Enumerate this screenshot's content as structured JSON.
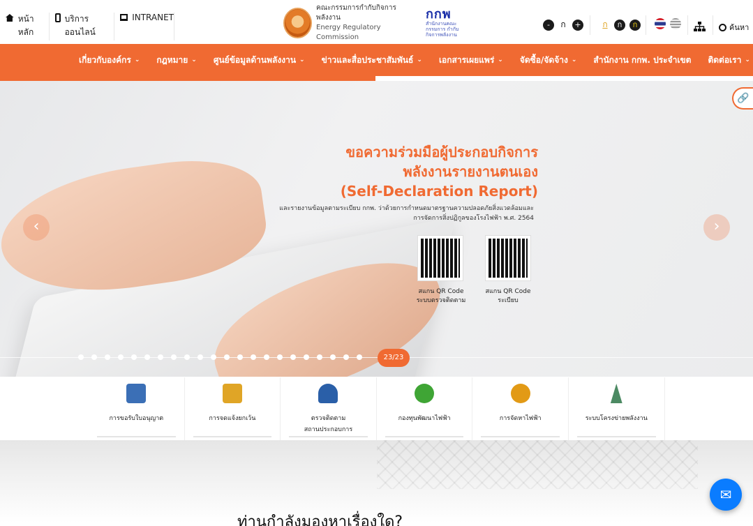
{
  "topbar": {
    "home": "หน้าหลัก",
    "online": "บริการออนไลน์",
    "intranet": "INTRANET",
    "font_minus": "-",
    "font_normal": "ก",
    "font_plus": "+",
    "contrast_normal": "ก",
    "contrast_dark": "ก",
    "contrast_yellow": "ก",
    "search": "ค้นหา"
  },
  "logo": {
    "org_th": "คณะกรรมการกำกับกิจการพลังงาน",
    "org_en": "Energy Regulatory Commission",
    "brand": "กกพ",
    "brand_sub": "สำนักงานคณะกรรมการ กำกับกิจการพลังงาน"
  },
  "nav": {
    "items": [
      "เกี่ยวกับองค์กร",
      "กฎหมาย",
      "ศูนย์ข้อมูลด้านพลังงาน",
      "ข่าวและสื่อประชาสัมพันธ์",
      "เอกสารเผยแพร่",
      "จัดซื้อ/จัดจ้าง",
      "สำนักงาน กกพ. ประจำเขต",
      "ติดต่อเรา"
    ]
  },
  "slide": {
    "title1": "ขอความร่วมมือผู้ประกอบกิจการ",
    "title2": "พลังงานรายงานตนเอง",
    "title3": "(Self-Declaration Report)",
    "sub1": "และรายงานข้อมูลตามระเบียบ กกพ. ว่าด้วยการกำหนดมาตรฐานความปลอดภัยสิ่งแวดล้อมและ",
    "sub2": "การจัดการสิ่งปฏิกูลของโรงไฟฟ้า พ.ศ. 2564",
    "qr1_line1": "สแกน QR Code",
    "qr1_line2": "ระบบตรวจติดตาม",
    "qr2_line1": "สแกน QR Code",
    "qr2_line2": "ระเบียบ",
    "counter": "23/23",
    "dot_count": 22
  },
  "services": [
    {
      "label": "การขอรับใบอนุญาต",
      "icon": "document-icon",
      "color": "#3b6fb6"
    },
    {
      "label": "การจดแจ้งยกเว้น",
      "icon": "clipboard-icon",
      "color": "#e0a526"
    },
    {
      "label": "ตรวจติดตาม สถานประกอบการ",
      "icon": "inspector-icon",
      "color": "#2a5fa8"
    },
    {
      "label": "กองทุนพัฒนาไฟฟ้า",
      "icon": "tree-icon",
      "color": "#3fa535"
    },
    {
      "label": "การจัดหาไฟฟ้า",
      "icon": "energy-hand-icon",
      "color": "#e29a16"
    },
    {
      "label": "ระบบโครงข่ายพลังงาน",
      "icon": "power-tower-icon",
      "color": "#4c8a63"
    }
  ],
  "lower": {
    "headline": "ท่านกำลังมองหาเรื่องใด?"
  }
}
